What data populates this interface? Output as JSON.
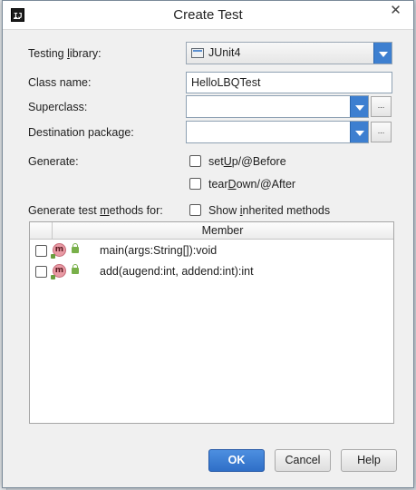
{
  "window": {
    "title": "Create Test",
    "close_glyph": "✕"
  },
  "form": {
    "testing_library": {
      "label": "Testing library:",
      "label_pre": "Testing ",
      "label_mnemonic": "l",
      "label_post": "ibrary:",
      "value": "JUnit4"
    },
    "class_name": {
      "label": "Class name:",
      "value": "HelloLBQTest"
    },
    "superclass": {
      "label": "Superclass:",
      "value": "",
      "browse": "..."
    },
    "destination_package": {
      "label": "Destination package:",
      "value": "",
      "browse": "..."
    },
    "generate": {
      "label": "Generate:",
      "options": [
        {
          "label": "setUp/@Before",
          "pre": "set",
          "mnemonic": "U",
          "post": "p/@Before",
          "checked": false
        },
        {
          "label": "tearDown/@After",
          "pre": "tear",
          "mnemonic": "D",
          "post": "own/@After",
          "checked": false
        }
      ]
    },
    "methods": {
      "label": "Generate test methods for:",
      "label_pre": "Generate test ",
      "label_mnemonic": "m",
      "label_post": "ethods for:",
      "show_inherited": {
        "label": "Show inherited methods",
        "pre": "Show ",
        "mnemonic": "i",
        "post": "nherited methods",
        "checked": false
      },
      "column_header": "Member",
      "rows": [
        {
          "icon": "method-icon",
          "icon_letter": "m",
          "visibility": "public-lock-icon",
          "signature": "main(args:String[]):void",
          "checked": false
        },
        {
          "icon": "method-icon",
          "icon_letter": "m",
          "visibility": "public-lock-icon",
          "signature": "add(augend:int, addend:int):int",
          "checked": false
        }
      ]
    }
  },
  "buttons": {
    "ok": "OK",
    "cancel": "Cancel",
    "help": "Help"
  },
  "colors": {
    "accent": "#3d7fd0",
    "primary_button": "#2f6fc7",
    "method_icon": "#e99aa4",
    "visibility_icon": "#79b04a"
  }
}
